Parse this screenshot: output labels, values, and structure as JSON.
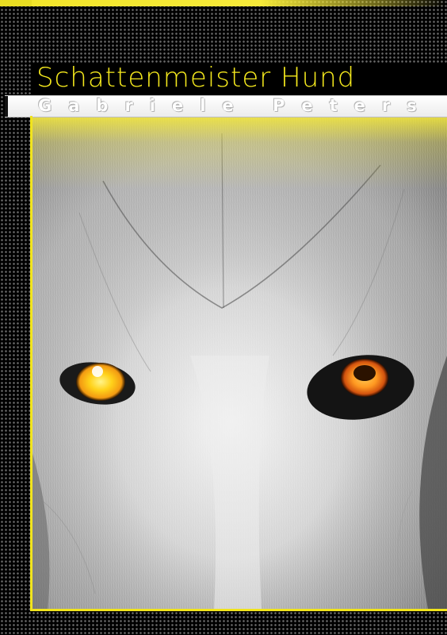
{
  "book": {
    "title": "Schattenmeister Hund",
    "author": "Gabriele Peters"
  },
  "colors": {
    "accent_yellow": "#f4e81d",
    "eye_yellow": "#ffd21a",
    "eye_orange": "#ff8a1c",
    "frame_black": "#000000"
  }
}
